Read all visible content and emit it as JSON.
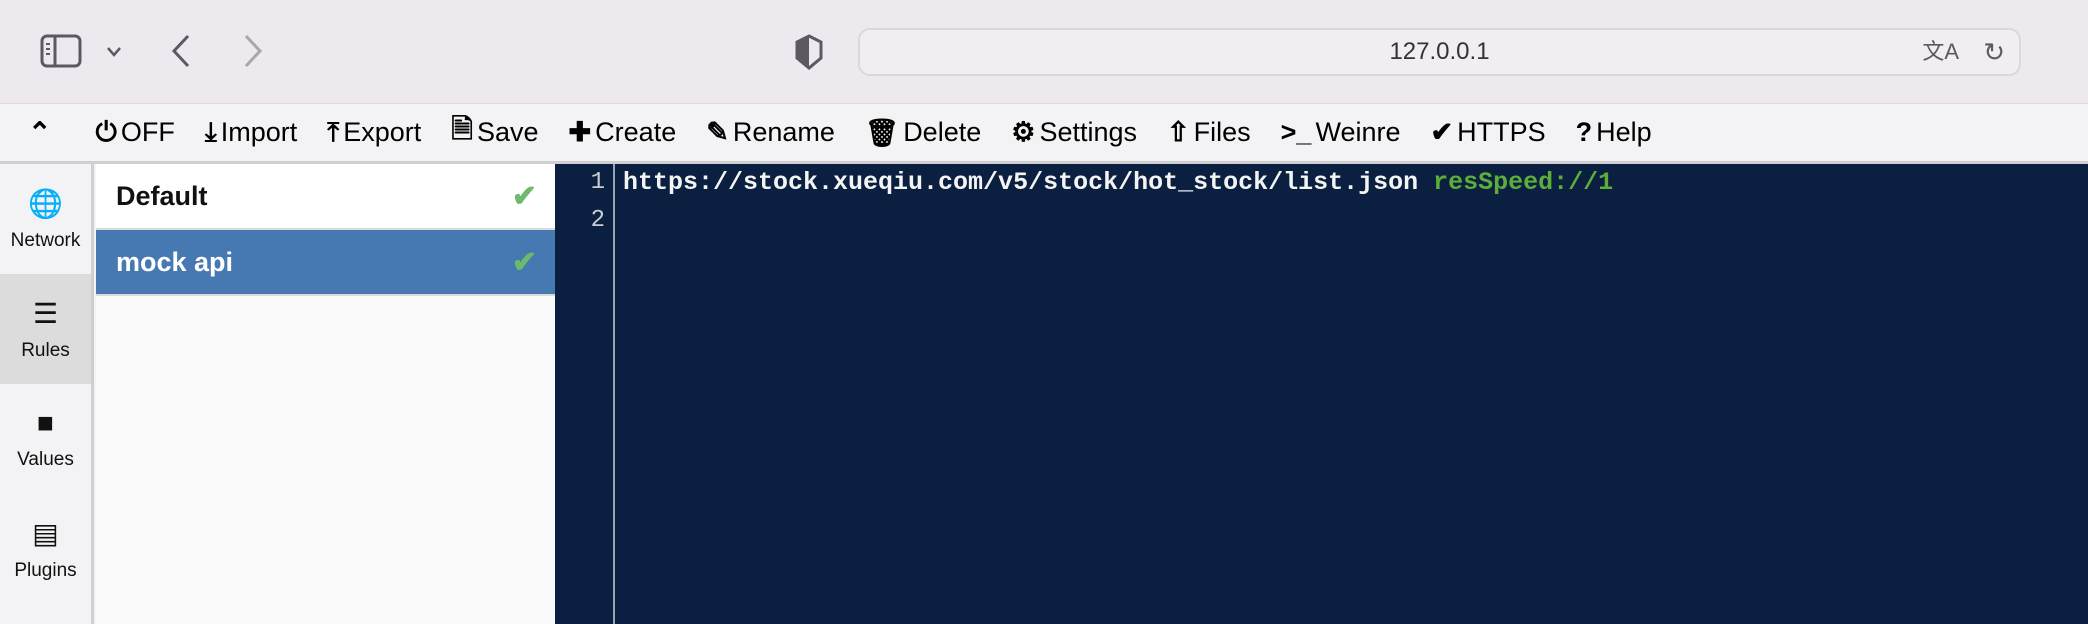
{
  "browser": {
    "url": "127.0.0.1",
    "icons": [
      "sidebar-icon",
      "chevron-down-icon",
      "back-icon",
      "forward-icon",
      "shield-icon",
      "translate-icon",
      "reload-icon"
    ]
  },
  "toolbar": {
    "items": [
      {
        "icon": "power-icon",
        "glyph": "⏻",
        "label": "OFF"
      },
      {
        "icon": "import-icon",
        "glyph": "⤓",
        "label": "Import"
      },
      {
        "icon": "export-icon",
        "glyph": "⤒",
        "label": "Export"
      },
      {
        "icon": "save-icon",
        "glyph": "🗎",
        "label": "Save"
      },
      {
        "icon": "plus-icon",
        "glyph": "✚",
        "label": "Create"
      },
      {
        "icon": "edit-icon",
        "glyph": "✎",
        "label": "Rename"
      },
      {
        "icon": "trash-icon",
        "glyph": "🗑",
        "label": "Delete"
      },
      {
        "icon": "gear-icon",
        "glyph": "⚙",
        "label": "Settings"
      },
      {
        "icon": "upload-icon",
        "glyph": "⇧",
        "label": "Files"
      },
      {
        "icon": "terminal-icon",
        "glyph": ">_",
        "label": "Weinre"
      },
      {
        "icon": "check-icon",
        "glyph": "✔",
        "label": "HTTPS"
      },
      {
        "icon": "help-icon",
        "glyph": "?",
        "label": "Help"
      }
    ]
  },
  "nav": {
    "items": [
      {
        "icon": "globe-icon",
        "glyph": "🌐",
        "label": "Network"
      },
      {
        "icon": "list-icon",
        "glyph": "☰",
        "label": "Rules",
        "selected": true
      },
      {
        "icon": "folder-icon",
        "glyph": "■",
        "label": "Values"
      },
      {
        "icon": "plugin-icon",
        "glyph": "▤",
        "label": "Plugins"
      }
    ]
  },
  "rules": [
    {
      "name": "Default",
      "active": true
    },
    {
      "name": "mock api",
      "active": true,
      "selected": true
    }
  ],
  "editor": {
    "line_numbers": [
      "1",
      "2"
    ],
    "line1_url": "https://stock.xueqiu.com/v5/stock/hot_stock/list.json ",
    "line1_rule": "resSpeed://1"
  },
  "colors": {
    "selected": "#4679b1",
    "editor_bg": "#0b2040",
    "check": "#6cba6c",
    "rule_keyword": "#5bae3a"
  }
}
